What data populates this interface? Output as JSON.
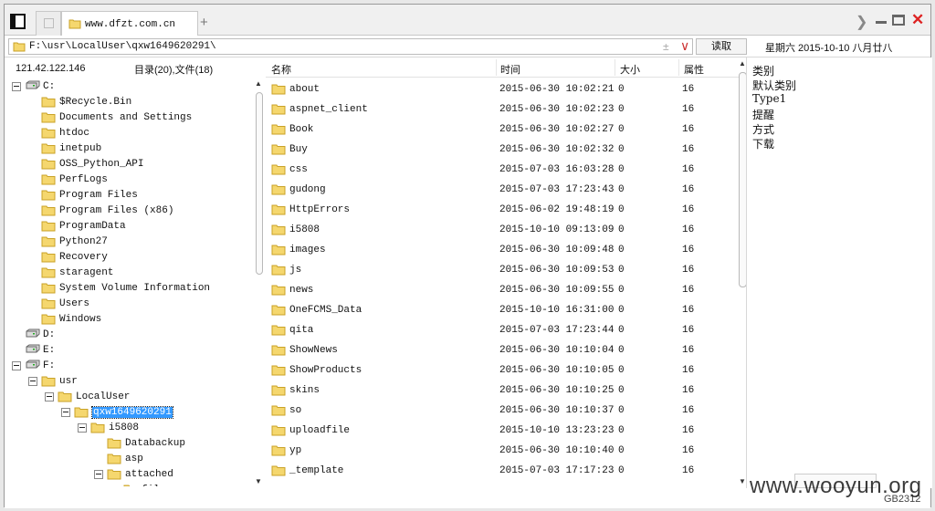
{
  "tab": {
    "title": "www.dfzt.com.cn",
    "new_tab": "+"
  },
  "address": {
    "path": "F:\\usr\\LocalUser\\qxw1649620291\\",
    "read_button": "读取",
    "date_text": "星期六 2015-10-10 八月廿八"
  },
  "left": {
    "ip": "121.42.122.146",
    "counts": "目录(20),文件(18)"
  },
  "tree": [
    {
      "label": "C:",
      "kind": "drive",
      "level": 0,
      "expanded": true
    },
    {
      "label": "$Recycle.Bin",
      "kind": "folder",
      "level": 1
    },
    {
      "label": "Documents and Settings",
      "kind": "folder",
      "level": 1
    },
    {
      "label": "htdoc",
      "kind": "folder",
      "level": 1
    },
    {
      "label": "inetpub",
      "kind": "folder",
      "level": 1
    },
    {
      "label": "OSS_Python_API",
      "kind": "folder",
      "level": 1
    },
    {
      "label": "PerfLogs",
      "kind": "folder",
      "level": 1
    },
    {
      "label": "Program Files",
      "kind": "folder",
      "level": 1
    },
    {
      "label": "Program Files (x86)",
      "kind": "folder",
      "level": 1
    },
    {
      "label": "ProgramData",
      "kind": "folder",
      "level": 1
    },
    {
      "label": "Python27",
      "kind": "folder",
      "level": 1
    },
    {
      "label": "Recovery",
      "kind": "folder",
      "level": 1
    },
    {
      "label": "staragent",
      "kind": "folder",
      "level": 1
    },
    {
      "label": "System Volume Information",
      "kind": "folder",
      "level": 1
    },
    {
      "label": "Users",
      "kind": "folder",
      "level": 1
    },
    {
      "label": "Windows",
      "kind": "folder",
      "level": 1
    },
    {
      "label": "D:",
      "kind": "drive",
      "level": 0
    },
    {
      "label": "E:",
      "kind": "drive",
      "level": 0
    },
    {
      "label": "F:",
      "kind": "drive",
      "level": 0,
      "expanded": true
    },
    {
      "label": "usr",
      "kind": "folder",
      "level": 1,
      "expanded": true
    },
    {
      "label": "LocalUser",
      "kind": "folder",
      "level": 2,
      "expanded": true
    },
    {
      "label": "qxw1649620291",
      "kind": "folder",
      "level": 3,
      "expanded": true,
      "selected": true
    },
    {
      "label": "i5808",
      "kind": "folder",
      "level": 4,
      "expanded": true
    },
    {
      "label": "Databackup",
      "kind": "folder",
      "level": 5
    },
    {
      "label": "asp",
      "kind": "folder",
      "level": 5
    },
    {
      "label": "attached",
      "kind": "folder",
      "level": 5,
      "expanded": true
    },
    {
      "label": "file",
      "kind": "folder",
      "level": 6,
      "partial": true
    }
  ],
  "list": {
    "headers": {
      "name": "名称",
      "time": "时间",
      "size": "大小",
      "attr": "属性"
    },
    "rows": [
      {
        "name": "about",
        "time": "2015-06-30 10:02:21",
        "size": "0",
        "attr": "16"
      },
      {
        "name": "aspnet_client",
        "time": "2015-06-30 10:02:23",
        "size": "0",
        "attr": "16"
      },
      {
        "name": "Book",
        "time": "2015-06-30 10:02:27",
        "size": "0",
        "attr": "16"
      },
      {
        "name": "Buy",
        "time": "2015-06-30 10:02:32",
        "size": "0",
        "attr": "16"
      },
      {
        "name": "css",
        "time": "2015-07-03 16:03:28",
        "size": "0",
        "attr": "16"
      },
      {
        "name": "gudong",
        "time": "2015-07-03 17:23:43",
        "size": "0",
        "attr": "16"
      },
      {
        "name": "HttpErrors",
        "time": "2015-06-02 19:48:19",
        "size": "0",
        "attr": "16"
      },
      {
        "name": "i5808",
        "time": "2015-10-10 09:13:09",
        "size": "0",
        "attr": "16"
      },
      {
        "name": "images",
        "time": "2015-06-30 10:09:48",
        "size": "0",
        "attr": "16"
      },
      {
        "name": "js",
        "time": "2015-06-30 10:09:53",
        "size": "0",
        "attr": "16"
      },
      {
        "name": "news",
        "time": "2015-06-30 10:09:55",
        "size": "0",
        "attr": "16"
      },
      {
        "name": "OneFCMS_Data",
        "time": "2015-10-10 16:31:00",
        "size": "0",
        "attr": "16"
      },
      {
        "name": "qita",
        "time": "2015-07-03 17:23:44",
        "size": "0",
        "attr": "16"
      },
      {
        "name": "ShowNews",
        "time": "2015-06-30 10:10:04",
        "size": "0",
        "attr": "16"
      },
      {
        "name": "ShowProducts",
        "time": "2015-06-30 10:10:05",
        "size": "0",
        "attr": "16"
      },
      {
        "name": "skins",
        "time": "2015-06-30 10:10:25",
        "size": "0",
        "attr": "16"
      },
      {
        "name": "so",
        "time": "2015-06-30 10:10:37",
        "size": "0",
        "attr": "16"
      },
      {
        "name": "uploadfile",
        "time": "2015-10-10 13:23:23",
        "size": "0",
        "attr": "16"
      },
      {
        "name": "yp",
        "time": "2015-06-30 10:10:40",
        "size": "0",
        "attr": "16"
      },
      {
        "name": "_template",
        "time": "2015-07-03 17:17:23",
        "size": "0",
        "attr": "16"
      }
    ]
  },
  "right": {
    "lines": [
      "类别",
      "默认类别",
      "Type1",
      "提醒",
      "方式",
      "下载"
    ]
  },
  "status": {
    "encoding": "GB2312"
  },
  "watermark": {
    "text": "www.wooyun.org"
  },
  "icons": {
    "folder": "folder-icon",
    "drive": "drive-icon",
    "tree_toggle": "minus-box-icon",
    "sidebar_toggle": "sidebar-toggle-icon",
    "close": "close-icon",
    "minimize": "minimize-icon",
    "maximize": "maximize-icon",
    "chevron_right": "chevron-right-icon",
    "scroll_up": "triangle-up-icon",
    "scroll_down": "triangle-down-icon"
  },
  "colors": {
    "folder_fill": "#f5d76e",
    "folder_stroke": "#c9a227",
    "selection": "#3399ff",
    "close": "#dd2222"
  }
}
